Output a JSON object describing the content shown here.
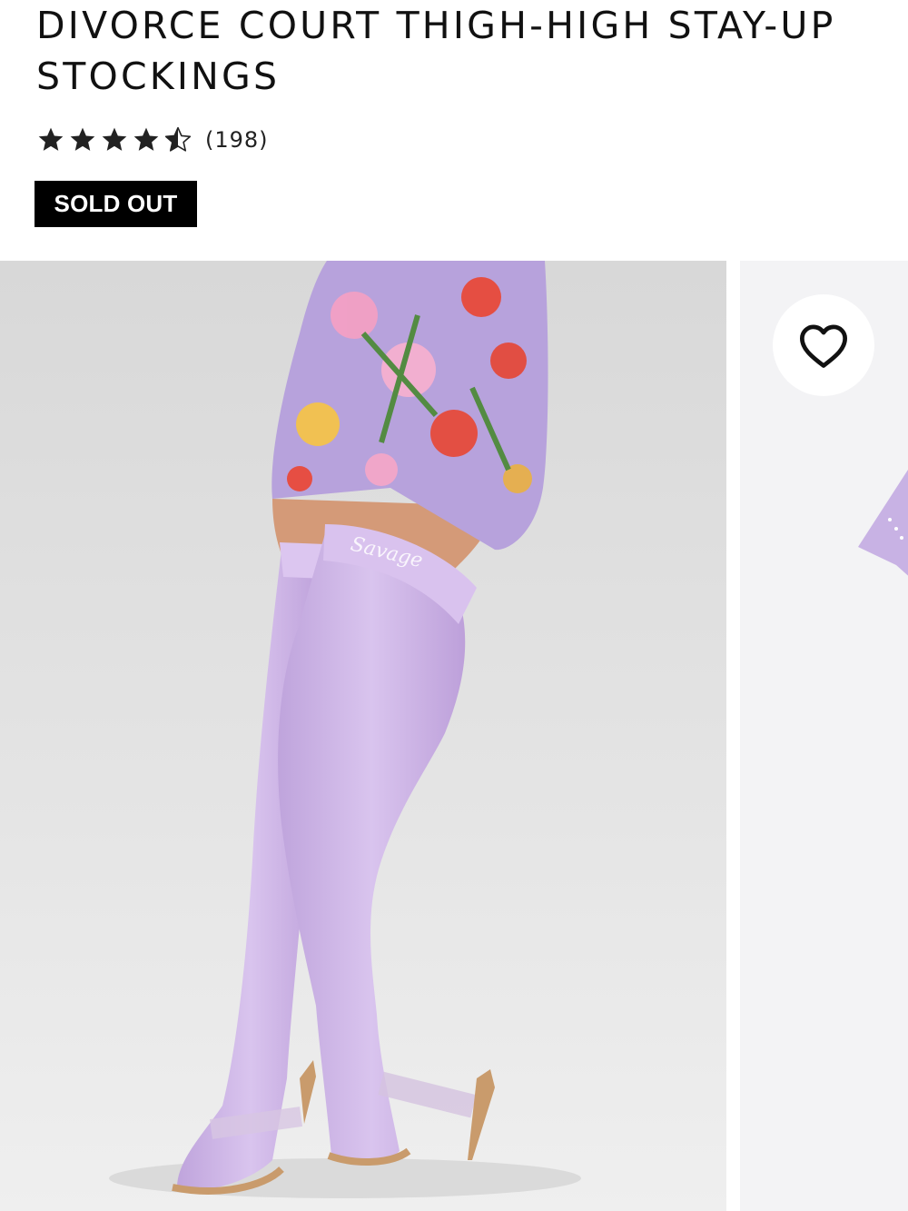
{
  "product": {
    "title": "DIVORCE COURT THIGH-HIGH STAY-UP STOCKINGS",
    "rating": 4.5,
    "rating_max": 5,
    "review_count": "(198)",
    "status_badge": "SOLD OUT"
  },
  "gallery": {
    "current_image": 1,
    "wishlist_icon": "heart-outline-icon"
  },
  "colors": {
    "badge_bg": "#000000",
    "badge_text": "#ffffff",
    "stocking": "#cdb3e6",
    "dress_base": "#b7a2dc",
    "backdrop": "#e2e2e2",
    "heart": "#111111"
  }
}
